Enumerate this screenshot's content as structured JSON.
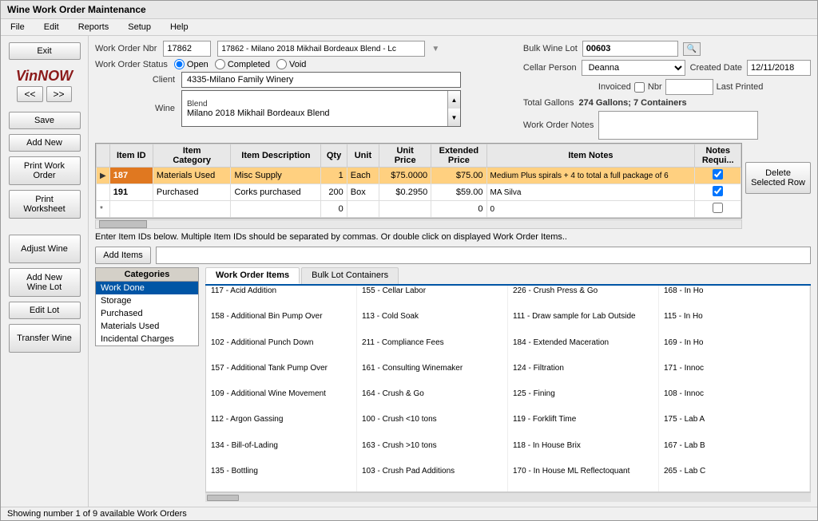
{
  "window": {
    "title": "Wine Work Order Maintenance"
  },
  "menu": {
    "items": [
      "File",
      "Edit",
      "Reports",
      "Setup",
      "Help"
    ]
  },
  "sidebar": {
    "exit_label": "Exit",
    "logo_text": "VinNOW",
    "nav_left": "<<",
    "nav_right": ">>",
    "save_label": "Save",
    "add_new_label": "Add New",
    "print_work_order_label": "Print Work Order",
    "print_worksheet_label": "Print Worksheet",
    "adjust_wine_label": "Adjust Wine",
    "add_new_wine_lot_label": "Add New Wine Lot",
    "edit_lot_label": "Edit Lot",
    "transfer_wine_label": "Transfer Wine"
  },
  "form": {
    "work_order_nbr_label": "Work Order Nbr",
    "work_order_nbr_value": "17862",
    "work_order_desc": "17862 - Milano 2018 Mikhail Bordeaux Blend - Lc",
    "work_order_status_label": "Work Order Status",
    "status_open": "Open",
    "status_completed": "Completed",
    "status_void": "Void",
    "client_label": "Client",
    "client_value": "4335-Milano Family Winery",
    "wine_label": "Wine",
    "wine_blend": "Blend",
    "wine_name": "Milano 2018 Mikhail Bordeaux Blend",
    "bulk_wine_lot_label": "Bulk Wine Lot",
    "bulk_wine_lot_value": "00603",
    "cellar_person_label": "Cellar Person",
    "cellar_person_value": "Deanna",
    "created_date_label": "Created Date",
    "created_date_value": "12/11/2018",
    "invoiced_label": "Invoiced",
    "nbr_label": "Nbr",
    "last_printed_label": "Last Printed",
    "total_gallons_label": "Total Gallons",
    "total_gallons_value": "274 Gallons;  7 Containers",
    "work_order_notes_label": "Work Order Notes"
  },
  "table": {
    "headers": [
      "",
      "Item ID",
      "Item Category",
      "Item Description",
      "Qty",
      "Unit",
      "Unit Price",
      "Extended Price",
      "Item Notes",
      "Notes Requi..."
    ],
    "rows": [
      {
        "arrow": "▶",
        "item_id": "187",
        "category": "Materials Used",
        "description": "Misc Supply",
        "qty": "1",
        "unit": "Each",
        "unit_price": "$75.0000",
        "extended_price": "$75.00",
        "notes": "Medium Plus spirals + 4 to total a full package of 6",
        "notes_req": true,
        "selected": true
      },
      {
        "arrow": "",
        "item_id": "191",
        "category": "Purchased",
        "description": "Corks purchased",
        "qty": "200",
        "unit": "Box",
        "unit_price": "$0.2950",
        "extended_price": "$59.00",
        "notes": "MA Silva",
        "notes_req": true,
        "selected": false
      },
      {
        "arrow": "*",
        "item_id": "",
        "category": "",
        "description": "",
        "qty": "0",
        "unit": "",
        "unit_price": "",
        "extended_price": "0",
        "notes": "0",
        "notes_req": false,
        "selected": false
      }
    ],
    "delete_btn_label": "Delete\nSelected Row"
  },
  "enter_items_text": "Enter Item IDs below.   Multiple Item IDs should be separated by commas.  Or double click on displayed Work Order Items..",
  "add_items_btn": "Add Items",
  "tabs": [
    "Work Order Items",
    "Bulk Lot Containers"
  ],
  "categories": {
    "header": "Categories",
    "items": [
      "Work Done",
      "Storage",
      "Purchased",
      "Materials Used",
      "Incidental Charges"
    ]
  },
  "work_order_items": [
    "117 - Acid Addition",
    "155 - Cellar Labor",
    "226 - Crush Press & Go",
    "168 - In Ho",
    "158 - Additional Bin Pump Over",
    "113 - Cold Soak",
    "111 - Draw sample for Lab Outside",
    "115 - In Ho",
    "102 - Additional Punch Down",
    "211 - Compliance Fees",
    "184 - Extended Maceration",
    "169 - In Ho",
    "157 - Additional Tank Pump Over",
    "161 - Consulting Winemaker",
    "124 - Filtration",
    "171 - Innoc",
    "109 - Additional Wine Movement",
    "164 - Crush & Go",
    "125 - Fining",
    "108 - Innoc",
    "112 - Argon Gassing",
    "100 - Crush <10 tons",
    "119 - Forklift Time",
    "175 - Lab A",
    "134 - Bill-of-Lading",
    "163 - Crush >10 tons",
    "118 - In House Brix",
    "167 - Lab B",
    "135 - Bottling",
    "103 - Crush Pad Additions",
    "170 - In House ML Reflectoquant",
    "265 - Lab C"
  ],
  "status_bar": {
    "text": "Showing number 1 of 9 available Work Orders"
  },
  "colors": {
    "selected_row": "#FFD080",
    "header_bg": "#e8e8e8",
    "category_selected": "#0055a5",
    "tab_active_border": "#0055a5"
  }
}
